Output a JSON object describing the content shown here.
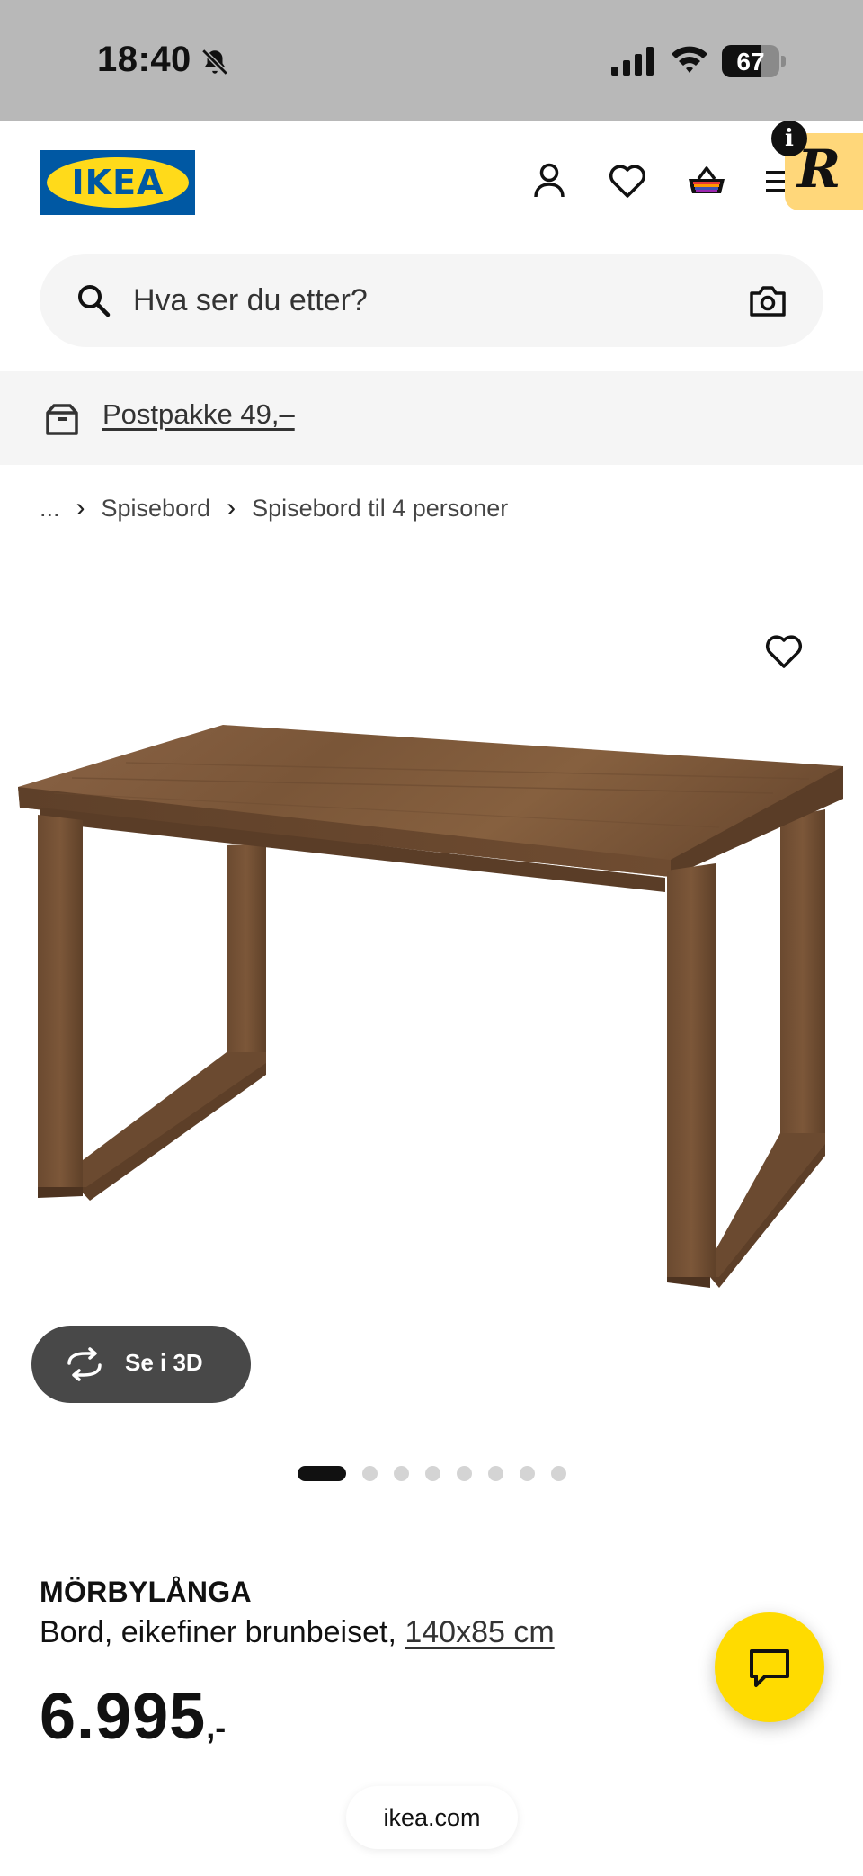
{
  "status_bar": {
    "time": "18:40",
    "battery": "67",
    "battery_level": 0.67,
    "icons": [
      "bell-muted-icon",
      "signal-icon",
      "wifi-icon",
      "battery-icon"
    ]
  },
  "header": {
    "logo_text": "IKEA",
    "icons": [
      "account-icon",
      "heart-icon",
      "basket-icon",
      "menu-icon"
    ],
    "extension_badge": "R",
    "info_badge": "i"
  },
  "search": {
    "placeholder": "Hva ser du etter?",
    "icons": [
      "search-icon",
      "camera-icon"
    ]
  },
  "banner": {
    "text": "Postpakke 49,–",
    "icon": "package-icon"
  },
  "breadcrumb": {
    "ellipsis": "...",
    "items": [
      "Spisebord",
      "Spisebord til 4 personer"
    ]
  },
  "gallery": {
    "view_3d_label": "Se i 3D",
    "image_count": 8,
    "active_index": 0
  },
  "product": {
    "name": "MÖRBYLÅNGA",
    "description": "Bord, eikefiner brunbeiset, ",
    "dimensions": "140x85 cm",
    "price": "6.995",
    "price_suffix": ",-"
  },
  "browser": {
    "url": "ikea.com"
  },
  "colors": {
    "ikea_blue": "#0058a3",
    "ikea_yellow": "#ffda1a",
    "chat_yellow": "#ffdb00",
    "status_bar_bg": "#b8b8b8"
  }
}
